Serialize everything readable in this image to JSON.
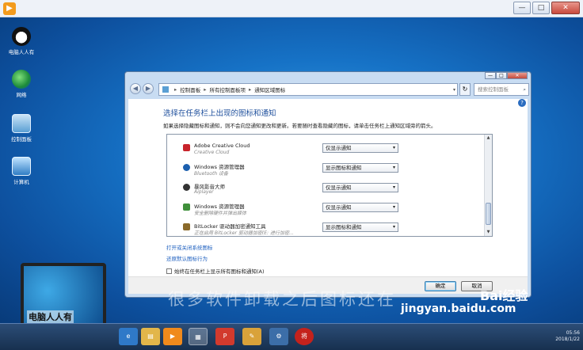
{
  "app_window": {
    "app_icon": "play-icon",
    "buttons": [
      "—",
      "□",
      "✕"
    ]
  },
  "desktop": {
    "icons": [
      {
        "label": "电脑人人有",
        "icon": "panda-icon"
      },
      {
        "label": "网络",
        "icon": "network-icon"
      },
      {
        "label": "控制面板",
        "icon": "control-panel-icon"
      },
      {
        "label": "计算机",
        "icon": "computer-icon"
      }
    ]
  },
  "dialog": {
    "breadcrumb": [
      "控制面板",
      "所有控制面板项",
      "通知区域图标"
    ],
    "search_placeholder": "搜索控制面板",
    "heading": "选择在任务栏上出现的图标和通知",
    "description": "如果选择隐藏图标和通知，则不会向您通知更改和更新。若要随时查看隐藏的图标，请单击任务栏上通知区域旁的箭头。",
    "rows": [
      {
        "name": "Adobe Creative Cloud",
        "sub": "Creative Cloud",
        "option": "仅显示通知",
        "icon_color": "#c8242b"
      },
      {
        "name": "Windows 资源管理器",
        "sub": "Bluetooth 设备",
        "option": "显示图标和通知",
        "icon_color": "#1c5fae"
      },
      {
        "name": "暴风影音大师",
        "sub": "Aiplayer",
        "option": "仅显示通知",
        "icon_color": "#333333"
      },
      {
        "name": "Windows 资源管理器",
        "sub": "安全删除硬件并弹出媒体",
        "option": "仅显示通知",
        "icon_color": "#3f8f3a"
      },
      {
        "name": "BitLocker 驱动器加密通知工具",
        "sub": "正在启用 BitLocker 驱动器加密(E: 进行加密...",
        "option": "显示图标和通知",
        "icon_color": "#8a6a2a"
      }
    ],
    "link_system_icons": "打开或关闭系统图标",
    "link_restore": "还原默认图标行为",
    "checkbox_label": "始终在任务栏上显示所有图标和通知(A)",
    "ok_label": "确定",
    "cancel_label": "取消"
  },
  "laptop_caption": "电脑人人有",
  "watermark_text": "很多软件卸载之后图标还在",
  "baidu": {
    "logo": "Bai经验",
    "url": "jingyan.baidu.com"
  },
  "clock": {
    "time": "05:56",
    "date": "2018/1/22"
  },
  "taskbar": {
    "icons": [
      "ie-icon",
      "folder-icon",
      "media-player-icon",
      "control-panel-icon",
      "wps-icon",
      "paint-icon",
      "settings-icon",
      "app-icon"
    ]
  }
}
